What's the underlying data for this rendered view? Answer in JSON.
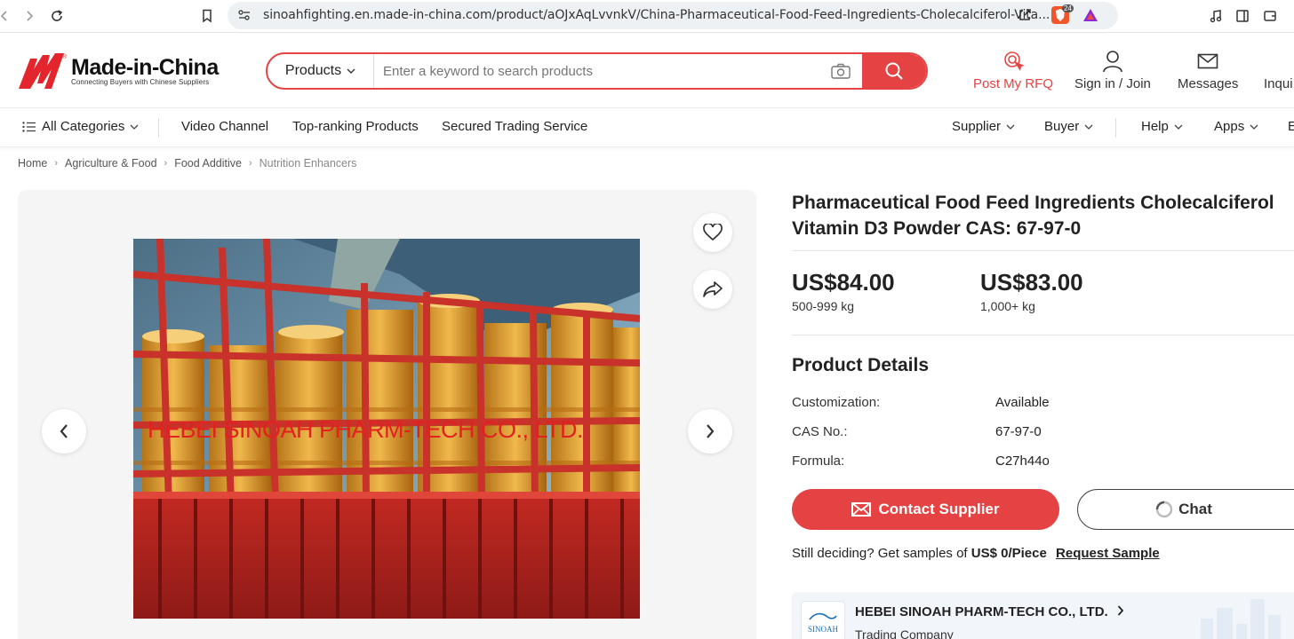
{
  "browser": {
    "url": "sinoahfighting.en.made-in-china.com/product/aOJxAqLvvnkV/China-Pharmaceutical-Food-Feed-Ingredients-Cholecalciferol-Vita...",
    "brave_count": "24"
  },
  "header": {
    "logo_text": "Made-in-China",
    "logo_tagline": "Connecting Buyers with Chinese Suppliers",
    "search_type": "Products",
    "search_placeholder": "Enter a keyword to search products",
    "links": {
      "post_rfq": "Post My RFQ",
      "sign_in": "Sign in / Join",
      "messages": "Messages",
      "inquiry": "Inqui"
    },
    "accent_color": "#e54343"
  },
  "nav": {
    "all_categories": "All Categories",
    "items": [
      "Video Channel",
      "Top-ranking Products",
      "Secured Trading Service"
    ],
    "right_items": [
      "Supplier",
      "Buyer",
      "Help",
      "Apps"
    ],
    "cut_item": "E"
  },
  "breadcrumb": [
    "Home",
    "Agriculture & Food",
    "Food Additive",
    "Nutrition Enhancers"
  ],
  "gallery": {
    "watermark": "HEBEI SINOAH PHARM-TECH CO., LTD."
  },
  "product": {
    "title": "Pharmaceutical Food Feed Ingredients Cholecalciferol Vitamin D3 Powder CAS: 67-97-0",
    "prices": [
      {
        "amount": "US$84.00",
        "qty": "500-999 kg"
      },
      {
        "amount": "US$83.00",
        "qty": "1,000+ kg"
      }
    ],
    "details_title": "Product Details",
    "details": [
      {
        "key": "Customization:",
        "value": "Available"
      },
      {
        "key": "CAS No.:",
        "value": "67-97-0"
      },
      {
        "key": "Formula:",
        "value": "C27h44o"
      }
    ],
    "contact_label": "Contact Supplier",
    "chat_label": "Chat",
    "sample_prefix": "Still deciding? Get samples of ",
    "sample_price": "US$ 0/Piece",
    "sample_link": "Request Sample"
  },
  "supplier": {
    "name": "HEBEI SINOAH PHARM-TECH CO., LTD.",
    "type": "Trading Company",
    "logo_text": "SINOAH"
  }
}
